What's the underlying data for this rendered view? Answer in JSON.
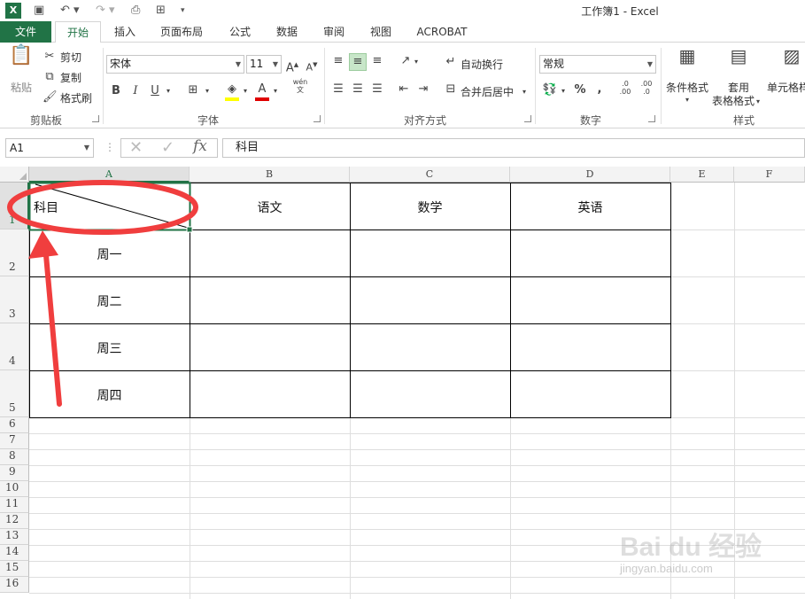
{
  "window": {
    "title": "工作簿1 - Excel"
  },
  "tabs": [
    {
      "label": "文件"
    },
    {
      "label": "开始"
    },
    {
      "label": "插入"
    },
    {
      "label": "页面布局"
    },
    {
      "label": "公式"
    },
    {
      "label": "数据"
    },
    {
      "label": "审阅"
    },
    {
      "label": "视图"
    },
    {
      "label": "ACROBAT"
    }
  ],
  "ribbon": {
    "clipboard": {
      "paste": "粘贴",
      "cut": "剪切",
      "copy": "复制",
      "format_painter": "格式刷",
      "group": "剪贴板"
    },
    "font": {
      "name": "宋体",
      "size": "11",
      "bold": "B",
      "italic": "I",
      "underline": "U",
      "group": "字体",
      "phonetic": "wén\n文"
    },
    "alignment": {
      "wrap": "自动换行",
      "merge": "合并后居中",
      "group": "对齐方式"
    },
    "number": {
      "format": "常规",
      "percent": "%",
      "comma": ",",
      "inc_dec": ".0\n.00",
      "dec_dec": ".00\n.0",
      "group": "数字"
    },
    "styles": {
      "cond_format": "条件格式",
      "table_format_1": "套用",
      "table_format_2": "表格格式",
      "cell_styles": "单元格样",
      "group": "样式"
    }
  },
  "formula_bar": {
    "name_box": "A1",
    "content": "科目"
  },
  "sheet": {
    "columns": [
      "A",
      "B",
      "C",
      "D",
      "E",
      "F"
    ],
    "rows": [
      "1",
      "2",
      "3",
      "4",
      "5",
      "6",
      "7",
      "8",
      "9",
      "10",
      "11",
      "12",
      "13",
      "14",
      "15",
      "16"
    ],
    "header_cells": {
      "a1": "科目",
      "b1": "语文",
      "c1": "数学",
      "d1": "英语"
    },
    "row_labels": [
      "周一",
      "周二",
      "周三",
      "周四"
    ]
  },
  "watermark": {
    "brand": "Bai du 经验",
    "url": "jingyan.baidu.com"
  },
  "colors": {
    "excel_green": "#217346",
    "annotation_red": "#f03e3e"
  }
}
